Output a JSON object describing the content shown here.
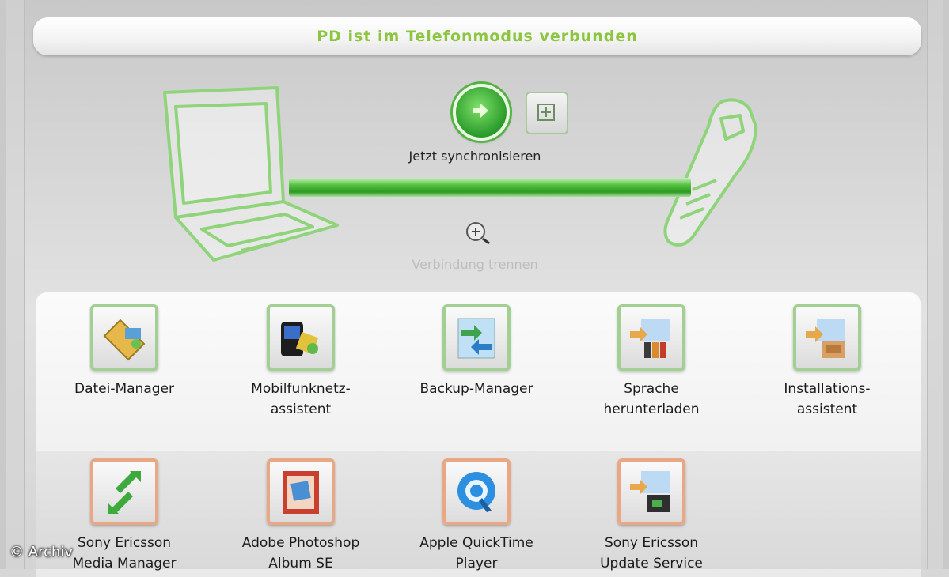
{
  "status": {
    "text": "PD ist im Telefonmodus verbunden"
  },
  "connection": {
    "sync_label": "Jetzt synchronisieren",
    "disconnect_label": "Verbindung trennen",
    "accent": "#4fbf3a"
  },
  "tools": [
    {
      "label": "Datei-Manager",
      "icon": "file-manager-icon"
    },
    {
      "label": "Mobilfunknetz-\nassistent",
      "icon": "mobile-network-icon"
    },
    {
      "label": "Backup-Manager",
      "icon": "backup-icon"
    },
    {
      "label": "Sprache\nherunterladen",
      "icon": "language-download-icon"
    },
    {
      "label": "Installations-\nassistent",
      "icon": "installation-icon"
    }
  ],
  "apps": [
    {
      "label": "Sony Ericsson\nMedia Manager",
      "icon": "media-manager-icon"
    },
    {
      "label": "Adobe Photoshop\nAlbum SE",
      "icon": "photoshop-album-icon"
    },
    {
      "label": "Apple QuickTime\nPlayer",
      "icon": "quicktime-icon"
    },
    {
      "label": "Sony Ericsson\nUpdate Service",
      "icon": "update-service-icon"
    }
  ],
  "watermark": "© Archiv"
}
